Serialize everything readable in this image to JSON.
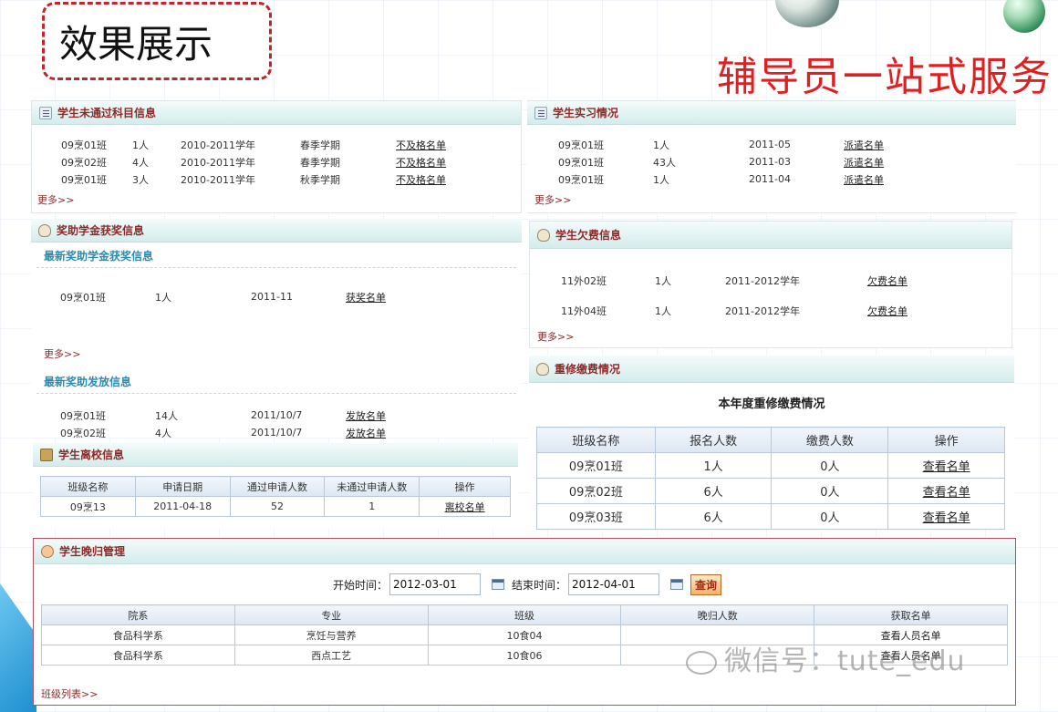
{
  "slide": {
    "title": "效果展示",
    "subtitle": "辅导员一站式服务"
  },
  "failing": {
    "header": "学生未通过科目信息",
    "rows": [
      {
        "class": "09烹01班",
        "count": "1人",
        "year": "2010-2011学年",
        "term": "春季学期",
        "link": "不及格名单"
      },
      {
        "class": "09烹02班",
        "count": "4人",
        "year": "2010-2011学年",
        "term": "春季学期",
        "link": "不及格名单"
      },
      {
        "class": "09烹01班",
        "count": "3人",
        "year": "2010-2011学年",
        "term": "秋季学期",
        "link": "不及格名单"
      }
    ],
    "more": "更多>>"
  },
  "internship": {
    "header": "学生实习情况",
    "rows": [
      {
        "class": "09烹01班",
        "count": "1人",
        "date": "2011-05",
        "link": "派遣名单"
      },
      {
        "class": "09烹01班",
        "count": "43人",
        "date": "2011-03",
        "link": "派遣名单"
      },
      {
        "class": "09烹01班",
        "count": "1人",
        "date": "2011-04",
        "link": "派遣名单"
      }
    ],
    "more": "更多>>"
  },
  "scholarship": {
    "header": "奖助学金获奖信息",
    "award_title": "最新奖助学金获奖信息",
    "award_rows": [
      {
        "class": "09烹01班",
        "count": "1人",
        "date": "2011-11",
        "link": "获奖名单"
      }
    ],
    "more": "更多>>",
    "issue_title": "最新奖助发放信息",
    "issue_rows": [
      {
        "class": "09烹01班",
        "count": "14人",
        "date": "2011/10/7",
        "link": "发放名单"
      },
      {
        "class": "09烹02班",
        "count": "4人",
        "date": "2011/10/7",
        "link": "发放名单"
      }
    ]
  },
  "arrears": {
    "header": "学生欠费信息",
    "rows": [
      {
        "class": "11外02班",
        "count": "1人",
        "year": "2011-2012学年",
        "link": "欠费名单"
      },
      {
        "class": "11外04班",
        "count": "1人",
        "year": "2011-2012学年",
        "link": "欠费名单"
      }
    ],
    "more": "更多>>"
  },
  "leave": {
    "header": "学生离校信息",
    "columns": [
      "班级名称",
      "申请日期",
      "通过申请人数",
      "未通过申请人数",
      "操作"
    ],
    "rows": [
      {
        "class": "09烹13",
        "date": "2011-04-18",
        "passed": "52",
        "failed": "1",
        "link": "离校名单"
      }
    ]
  },
  "retake": {
    "header": "重修缴费情况",
    "caption": "本年度重修缴费情况",
    "columns": [
      "班级名称",
      "报名人数",
      "缴费人数",
      "操作"
    ],
    "rows": [
      {
        "class": "09烹01班",
        "signed": "1人",
        "paid": "0人",
        "link": "查看名单"
      },
      {
        "class": "09烹02班",
        "signed": "6人",
        "paid": "0人",
        "link": "查看名单"
      },
      {
        "class": "09烹03班",
        "signed": "6人",
        "paid": "0人",
        "link": "查看名单"
      }
    ]
  },
  "night": {
    "header": "学生晚归管理",
    "start_label": "开始时间：",
    "start_value": "2012-03-01",
    "end_label": "结束时间：",
    "end_value": "2012-04-01",
    "query": "查询",
    "columns": [
      "院系",
      "专业",
      "班级",
      "晚归人数",
      "获取名单"
    ],
    "rows": [
      {
        "dept": "食品科学系",
        "major": "烹饪与营养",
        "class": "10食04",
        "late": "",
        "link": "查看人员名单"
      },
      {
        "dept": "食品科学系",
        "major": "西点工艺",
        "class": "10食06",
        "late": "",
        "link": "查看人员名单"
      }
    ],
    "list_link": "班级列表>>"
  },
  "watermark": "微信号：tute_edu"
}
